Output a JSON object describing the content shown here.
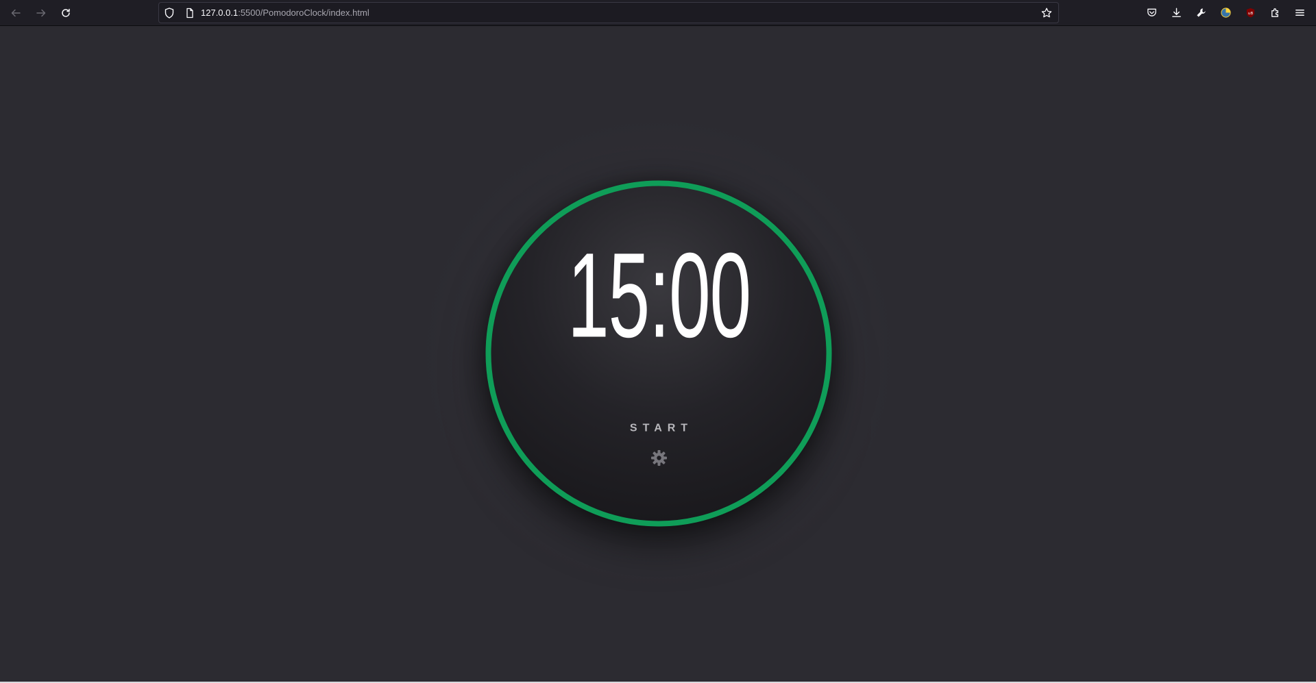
{
  "browser": {
    "url_host": "127.0.0.1",
    "url_rest": ":5500/PomodoroClock/index.html",
    "icons": {
      "back": "arrow-left-icon",
      "forward": "arrow-right-icon",
      "reload": "reload-icon",
      "tracking": "shield-icon",
      "page": "page-icon",
      "bookmark": "star-icon",
      "pocket": "pocket-icon",
      "downloads": "download-icon",
      "tools": "wrench-icon",
      "python": "python-icon",
      "ublock": "ublock-icon",
      "extensions": "extensions-icon",
      "menu": "hamburger-menu-icon"
    }
  },
  "timer": {
    "time": "15:00",
    "start_label": "START",
    "settings_icon": "gear-icon",
    "ring_color": "#0f9d58"
  }
}
